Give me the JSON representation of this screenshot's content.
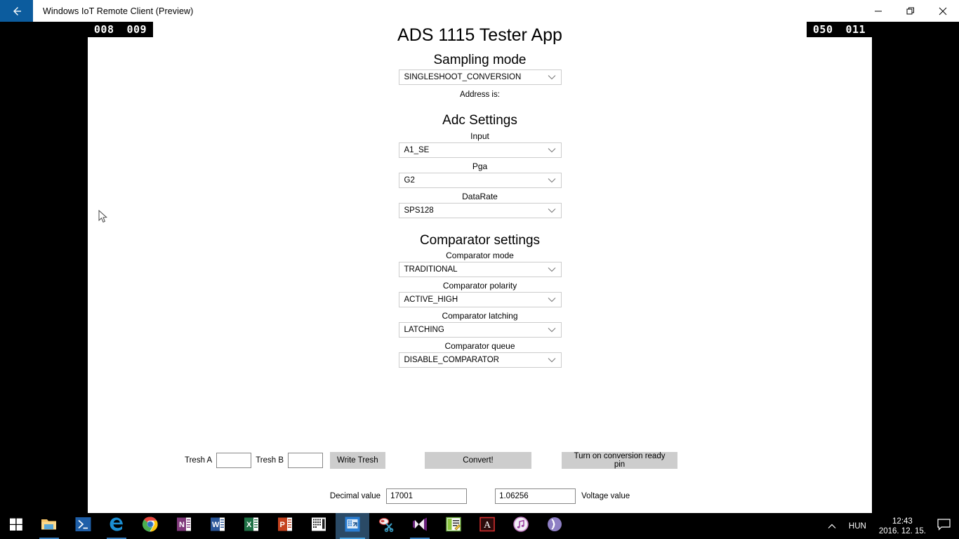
{
  "window": {
    "title": "Windows IoT Remote Client (Preview)",
    "back_icon": "back-arrow-icon",
    "minimize_label": "",
    "restore_label": "",
    "close_label": ""
  },
  "counters": {
    "left": [
      "008",
      "009"
    ],
    "right": [
      "050",
      "011"
    ]
  },
  "app": {
    "title": "ADS 1115 Tester App",
    "sampling": {
      "heading": "Sampling mode",
      "value": "SINGLESHOOT_CONVERSION",
      "address_text": "Address is:"
    },
    "adc": {
      "heading": "Adc Settings",
      "fields": [
        {
          "label": "Input",
          "value": "A1_SE"
        },
        {
          "label": "Pga",
          "value": "G2"
        },
        {
          "label": "DataRate",
          "value": "SPS128"
        }
      ]
    },
    "comparator": {
      "heading": "Comparator settings",
      "fields": [
        {
          "label": "Comparator mode",
          "value": "TRADITIONAL"
        },
        {
          "label": "Comparator polarity",
          "value": "ACTIVE_HIGH"
        },
        {
          "label": "Comparator latching",
          "value": "LATCHING"
        },
        {
          "label": "Comparator queue",
          "value": "DISABLE_COMPARATOR"
        }
      ]
    },
    "controls": {
      "tresh_a_label": "Tresh A",
      "tresh_a_value": "",
      "tresh_b_label": "Tresh B",
      "tresh_b_value": "",
      "write_tresh_label": "Write Tresh",
      "convert_label": "Convert!",
      "ready_pin_label": "Turn on conversion ready pin"
    },
    "values": {
      "decimal_label": "Decimal value",
      "decimal_value": "17001",
      "voltage_value": "1.06256",
      "voltage_label": "Voltage value"
    }
  },
  "taskbar": {
    "start_icon": "windows-start-icon",
    "items": [
      {
        "name": "file-explorer-icon",
        "label": "File Explorer"
      },
      {
        "name": "powershell-icon",
        "label": "Windows PowerShell"
      },
      {
        "name": "edge-icon",
        "label": "Microsoft Edge"
      },
      {
        "name": "chrome-icon",
        "label": "Google Chrome"
      },
      {
        "name": "onenote-icon",
        "label": "OneNote"
      },
      {
        "name": "word-icon",
        "label": "Word"
      },
      {
        "name": "excel-icon",
        "label": "Excel"
      },
      {
        "name": "powerpoint-icon",
        "label": "PowerPoint"
      },
      {
        "name": "calculator-icon",
        "label": "Calculator"
      },
      {
        "name": "iot-remote-client-icon",
        "label": "Windows IoT Remote Client"
      },
      {
        "name": "snipping-tool-icon",
        "label": "Snipping Tool"
      },
      {
        "name": "visual-studio-icon",
        "label": "Visual Studio"
      },
      {
        "name": "notepadpp-icon",
        "label": "Notepad++"
      },
      {
        "name": "adobe-acrobat-icon",
        "label": "Adobe Acrobat"
      },
      {
        "name": "itunes-icon",
        "label": "iTunes"
      },
      {
        "name": "bittorrent-icon",
        "label": "BitTorrent"
      }
    ],
    "tray": {
      "chevron_icon": "chevron-up-icon",
      "language": "HUN",
      "time": "12:43",
      "date": "2016. 12. 15.",
      "action_center_icon": "action-center-icon"
    }
  },
  "colors": {
    "accent_blue": "#0c5c9e",
    "button_gray": "#cdcdcd",
    "combo_border": "#cccccc",
    "taskbar_bg": "#000000"
  }
}
